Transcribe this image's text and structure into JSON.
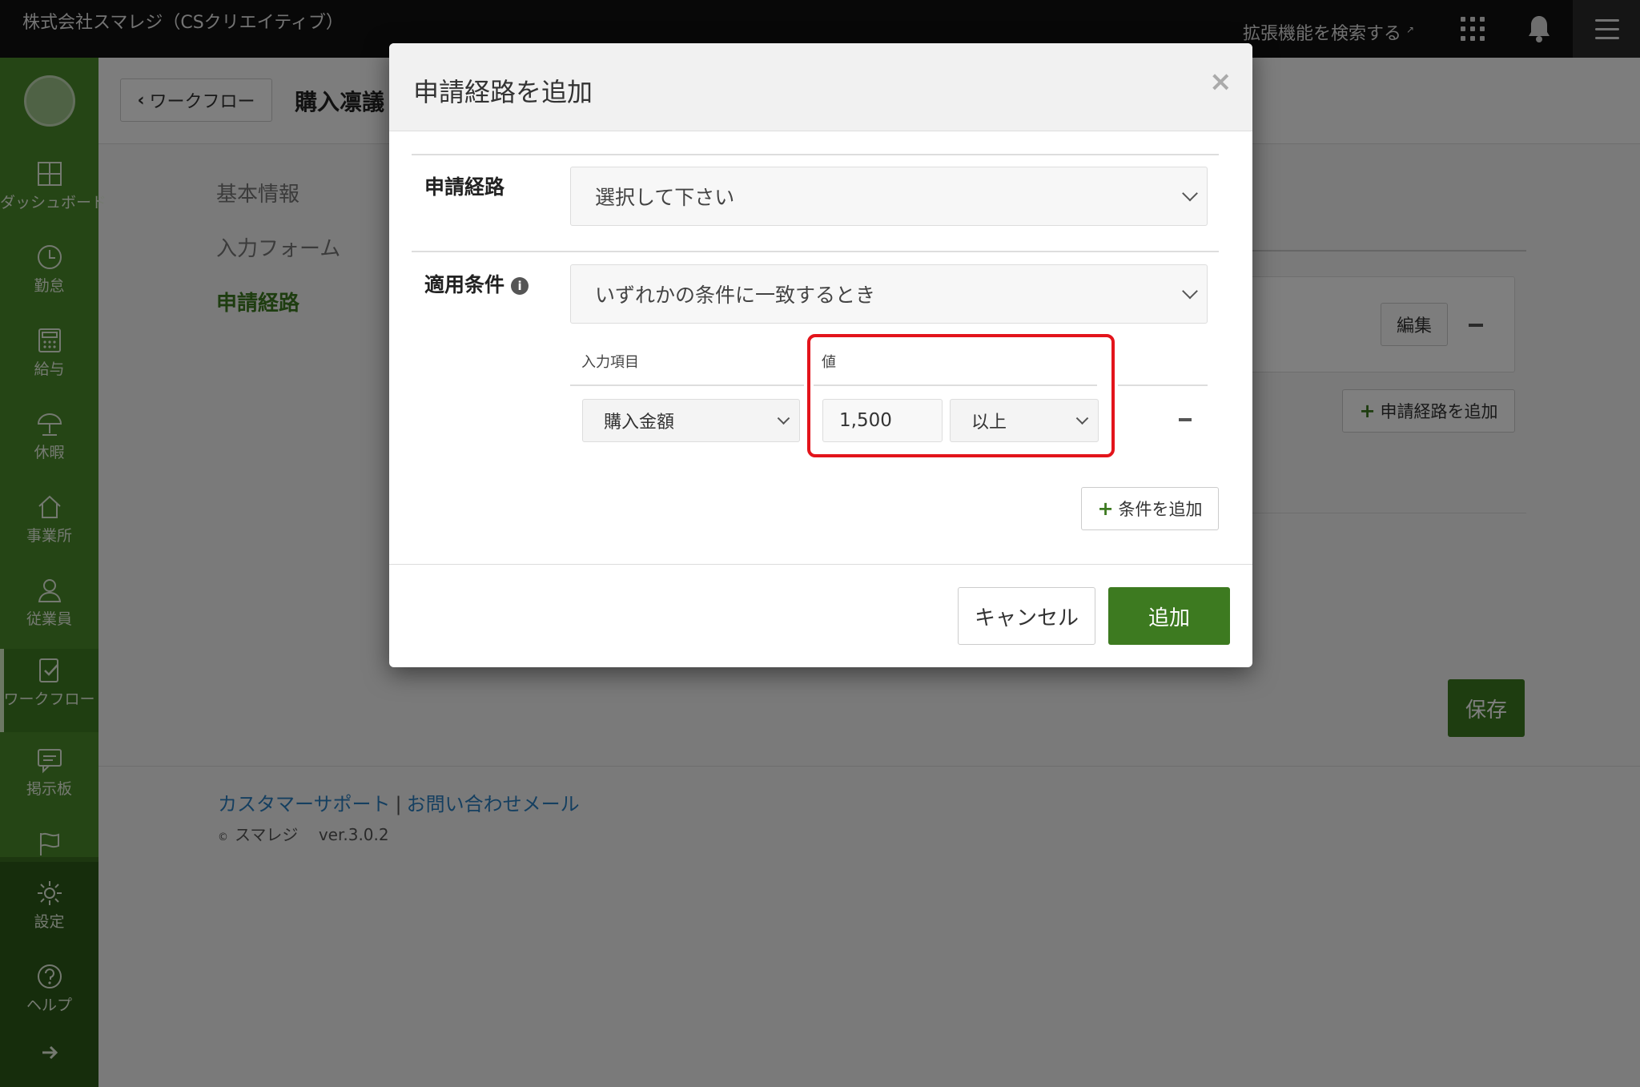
{
  "topbar": {
    "company": "株式会社スマレジ（CSクリエイティブ）",
    "extension_search": "拡張機能を検索する",
    "icons": [
      "external-link-icon",
      "app-grid-icon",
      "bell-icon",
      "hamburger-menu-icon"
    ]
  },
  "sidebar": {
    "items": [
      {
        "label": "ダッシュボード",
        "icon": "dashboard-icon"
      },
      {
        "label": "勤怠",
        "icon": "clock-icon"
      },
      {
        "label": "給与",
        "icon": "calculator-icon"
      },
      {
        "label": "休暇",
        "icon": "umbrella-icon"
      },
      {
        "label": "事業所",
        "icon": "home-icon"
      },
      {
        "label": "従業員",
        "icon": "person-icon"
      },
      {
        "label": "ワークフロー",
        "icon": "workflow-icon",
        "active": true
      },
      {
        "label": "掲示板",
        "icon": "message-board-icon"
      },
      {
        "label": "",
        "icon": "flag-icon"
      },
      {
        "label": "設定",
        "icon": "gear-icon"
      },
      {
        "label": "ヘルプ",
        "icon": "help-icon"
      },
      {
        "label": "",
        "icon": "arrow-right-icon"
      }
    ]
  },
  "page": {
    "back_label": "ワークフロー",
    "title": "購入凛議",
    "tabs": [
      "基本情報",
      "入力フォーム",
      "申請経路"
    ],
    "active_tab": "申請経路",
    "edit_label": "編集",
    "add_route_label": "申請経路を追加",
    "save_label": "保存"
  },
  "footer": {
    "support_link": "カスタマーサポート",
    "separator": "|",
    "contact_link": "お問い合わせメール",
    "copyright_mark": "©",
    "brand": "スマレジ",
    "version": "ver.3.0.2"
  },
  "modal": {
    "title": "申請経路を追加",
    "close": "×",
    "route_label": "申請経路",
    "route_select": "選択して下さい",
    "condition_label": "適用条件",
    "condition_select": "いずれかの条件に一致するとき",
    "columns": {
      "field": "入力項目",
      "value": "値"
    },
    "condition_row": {
      "field": "購入金額",
      "value": "1,500",
      "operator": "以上"
    },
    "add_condition_label": "条件を追加",
    "cancel_label": "キャンセル",
    "submit_label": "追加"
  },
  "colors": {
    "sidebar": "#4a8a2b",
    "accent": "#3d7a20",
    "topbar": "#111111",
    "link": "#2a7fc0",
    "highlight": "#e3141b"
  }
}
